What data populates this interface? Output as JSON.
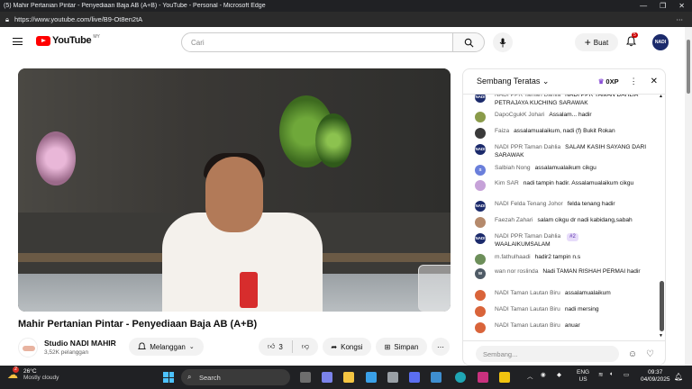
{
  "window": {
    "title": "(5) Mahir Pertanian Pintar - Penyediaan Baja AB (A+B) - YouTube - Personal - Microsoft Edge",
    "url": "https://www.youtube.com/live/B9-Ot8en2tA"
  },
  "header": {
    "logo_text": "YouTube",
    "logo_country": "MY",
    "search_placeholder": "Cari",
    "create_label": "Buat",
    "notification_count": "5",
    "avatar_text": "NADI"
  },
  "video": {
    "title": "Mahir Pertanian Pintar - Penyediaan Baja AB (A+B)",
    "channel_name": "Studio NADI MAHIR",
    "subscribers": "3,52K pelanggan",
    "subscribe_label": "Melanggan",
    "likes": "3",
    "share_label": "Kongsi",
    "save_label": "Simpan"
  },
  "chat": {
    "title": "Sembang Teratas",
    "points": "0XP",
    "input_placeholder": "Sembang...",
    "messages": [
      {
        "author": "NADI PPR Taman Dahlia",
        "text": "NADI PPR TAMAN DAHLIA PETRAJAYA KUCHING SARAWAK",
        "avatar": "nadi"
      },
      {
        "author": "DapoCgukK Johari",
        "text": "Assalam... hadir",
        "avatar": "photo1"
      },
      {
        "author": "Faiza",
        "text": "assalamualaikum, nadi (f) Bukit Rokan",
        "avatar": "photo2"
      },
      {
        "author": "NADI PPR Taman Dahlia",
        "text": "SALAM KASIH SAYANG DARI SARAWAK",
        "avatar": "nadi"
      },
      {
        "author": "Salbiah Nong",
        "text": "assalamualaikum cikgu",
        "avatar": "S"
      },
      {
        "author": "Kim SAR",
        "text": "nadi tampin hadir. Assalamualaikum cikgu",
        "avatar": "photo3"
      },
      {
        "author": "NADI Felda Tenang Johor",
        "text": "felda tenang hadir",
        "avatar": "nadi"
      },
      {
        "author": "Faezah Zahari",
        "text": "salam cikgu dr nadi kabidang,sabah",
        "avatar": "photo4"
      },
      {
        "author": "NADI PPR Taman Dahlia",
        "badge": "#2",
        "text": "WAALAIKUMSALAM",
        "avatar": "nadi"
      },
      {
        "author": "m.fathulhaadi",
        "text": "hadir2 tampin n.s",
        "avatar": "photo5"
      },
      {
        "author": "wan nor roslinda",
        "text": "Nadi TAMAN RISHAH PERMAI hadir",
        "avatar": "W"
      },
      {
        "author": "NADI Taman Lautan Biru",
        "text": "assalamualaikum",
        "avatar": "photo6"
      },
      {
        "author": "NADI Taman Lautan Biru",
        "text": "nadi mersing",
        "avatar": "photo6"
      },
      {
        "author": "NADI Taman Lautan Biru",
        "text": "anuar",
        "avatar": "photo6"
      }
    ]
  },
  "taskbar": {
    "temperature": "26°C",
    "weather": "Mostly cloudy",
    "weather_badge": "2",
    "search_label": "Search",
    "lang_top": "ENG",
    "lang_bottom": "US",
    "time": "09:37",
    "date": "04/09/2025"
  },
  "colors": {
    "youtube_red": "#ff0000",
    "nadi_navy": "#1b2a6b",
    "taskbar": "#202124"
  }
}
